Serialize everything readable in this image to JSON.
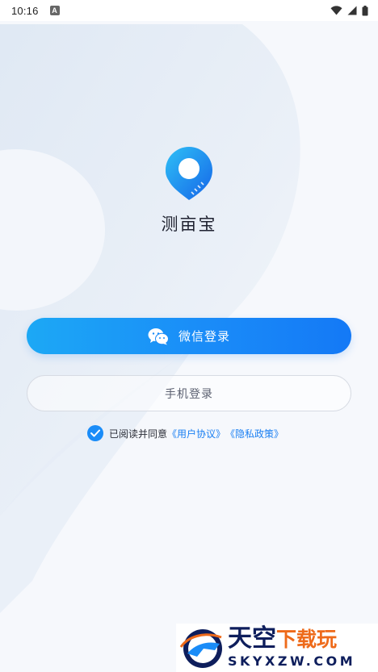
{
  "status_bar": {
    "time": "10:16",
    "notification_badge": "A",
    "icons": [
      "wifi-icon",
      "signal-icon",
      "battery-icon"
    ]
  },
  "app": {
    "name": "测亩宝",
    "logo": "location-pin-ruler-logo"
  },
  "login": {
    "wechat_label": "微信登录",
    "phone_label": "手机登录"
  },
  "agreement": {
    "checked": true,
    "prefix": "已阅读并同意",
    "user_agreement": "《用户协议》",
    "privacy_policy": "《隐私政策》"
  },
  "watermark": {
    "title_main": "天空",
    "title_accent": "下载玩",
    "subtitle": "SKYXZW.COM"
  },
  "colors": {
    "primary": "#1a8cf8",
    "primary_light": "#1ca8f5",
    "link": "#1a7ff2",
    "watermark_navy": "#0e1e5c",
    "watermark_orange": "#ee6a1a"
  }
}
